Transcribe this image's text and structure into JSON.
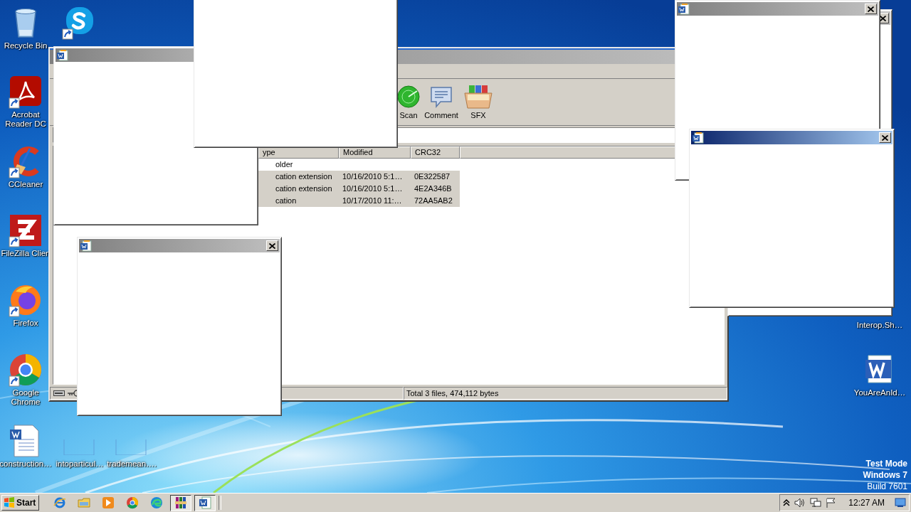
{
  "desktop_icons": [
    {
      "kind": "recycle",
      "label": "Recycle Bin"
    },
    {
      "kind": "skype"
    },
    {
      "kind": "acrobat",
      "label": "Acrobat Reader DC"
    },
    {
      "kind": "ccleaner",
      "label": "CCleaner"
    },
    {
      "kind": "filezilla",
      "label": "FileZilla Clien"
    },
    {
      "kind": "firefox",
      "label": "Firefox"
    },
    {
      "kind": "chrome",
      "label": "Google Chrome"
    },
    {
      "kind": "worddoc",
      "label": "construction…"
    },
    {
      "kind": "blank",
      "label": "intoparticul…"
    },
    {
      "kind": "blank",
      "label": "trademean…."
    },
    {
      "kind": "hidden",
      "label": "Interop.Sh…"
    },
    {
      "kind": "wordapp",
      "label": "YouAreAnId…"
    }
  ],
  "archive_window": {
    "toolbar": [
      {
        "kind": "scan",
        "label": "Scan"
      },
      {
        "kind": "comment",
        "label": "Comment"
      },
      {
        "kind": "sfx",
        "label": "SFX"
      }
    ],
    "columns": [
      "ype",
      "Modified",
      "CRC32"
    ],
    "rows": [
      {
        "cells": [
          "older",
          "",
          ""
        ],
        "selected": false
      },
      {
        "cells": [
          "cation extension",
          "10/16/2010 5:1…",
          "0E322587"
        ],
        "selected": true
      },
      {
        "cells": [
          "cation extension",
          "10/16/2010 5:1…",
          "4E2A346B"
        ],
        "selected": true
      },
      {
        "cells": [
          "cation",
          "10/17/2010 11:…",
          "72AA5AB2"
        ],
        "selected": true
      }
    ],
    "status": "Total 3 files, 474,112 bytes"
  },
  "popups": [
    {
      "kind": "titled",
      "active": false
    },
    {
      "kind": "titled",
      "active": false
    },
    {
      "kind": "titled",
      "active": true
    },
    {
      "kind": "titled",
      "active": false
    },
    {
      "kind": "body_only"
    },
    {
      "kind": "titled",
      "active": false
    }
  ],
  "system_notice": [
    "Test Mode",
    "Windows 7",
    "Build 7601"
  ],
  "taskbar": {
    "start": "Start",
    "apps": [
      {
        "kind": "ie",
        "pressed": false
      },
      {
        "kind": "explorer",
        "pressed": false
      },
      {
        "kind": "media",
        "pressed": false
      },
      {
        "kind": "chrome",
        "pressed": false
      },
      {
        "kind": "edge",
        "pressed": false
      },
      {
        "kind": "winrar",
        "pressed": true
      },
      {
        "kind": "word",
        "pressed": true
      }
    ],
    "clock": "12:27 AM"
  }
}
